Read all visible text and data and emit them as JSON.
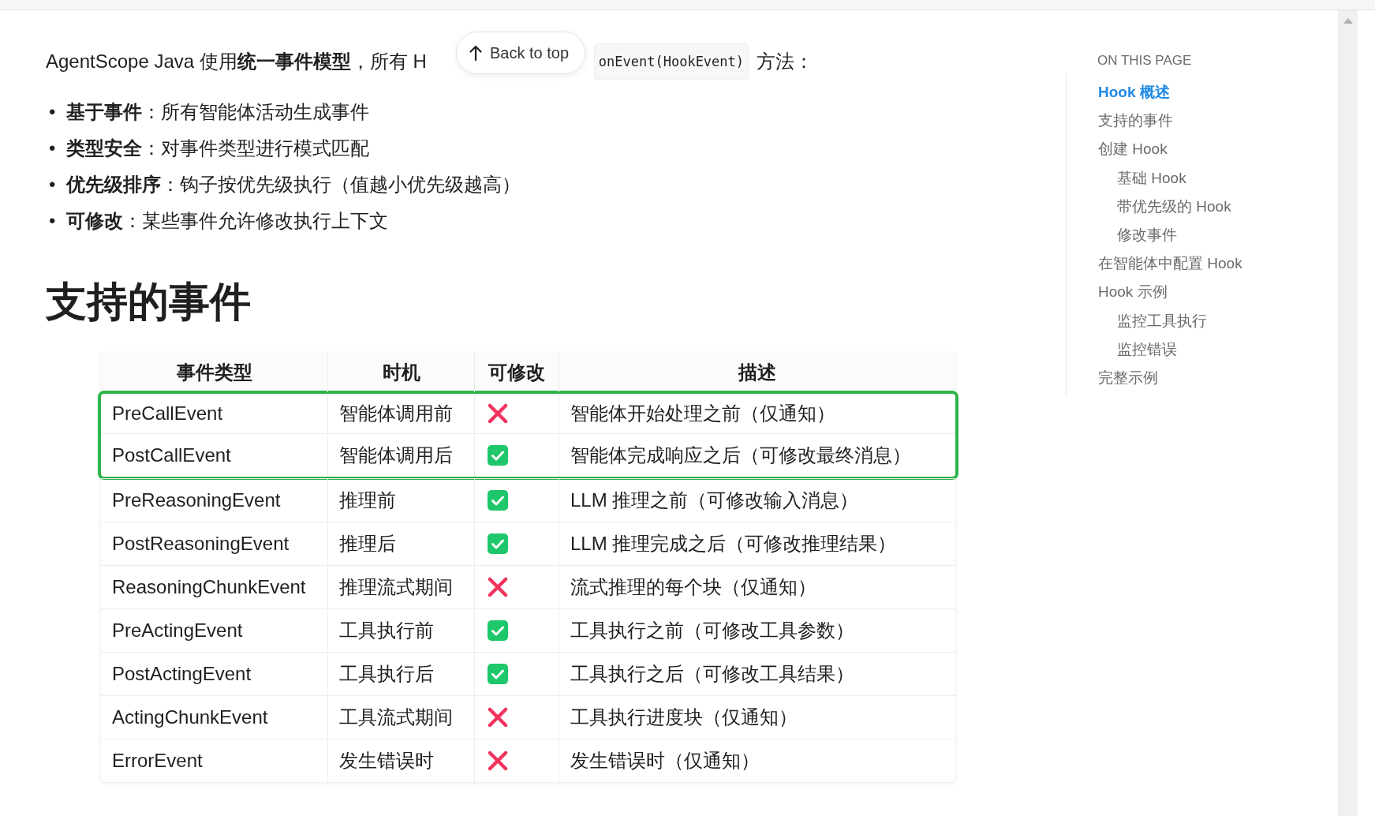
{
  "back_to_top": {
    "label": "Back to top"
  },
  "intro": {
    "before": "AgentScope Java 使用**统一事件模型**，所有 H",
    "code": "onEvent(HookEvent)",
    "after": "方法："
  },
  "bullets": [
    {
      "marker": "•",
      "text": "**基于事件**：所有智能体活动生成事件"
    },
    {
      "marker": "•",
      "text": "**类型安全**：对事件类型进行模式匹配"
    },
    {
      "marker": "•",
      "text": "**优先级排序**：钩子按优先级执行（值越小优先级越高）"
    },
    {
      "marker": "•",
      "text": "**可修改**：某些事件允许修改执行上下文"
    }
  ],
  "section_title": "支持的事件",
  "table": {
    "columns": [
      "事件类型",
      "时机",
      "可修改",
      "描述"
    ],
    "rows": [
      {
        "event": "PreCallEvent",
        "timing": "智能体调用前",
        "modifiable": false,
        "description": "智能体开始处理之前（仅通知）",
        "highlighted": true
      },
      {
        "event": "PostCallEvent",
        "timing": "智能体调用后",
        "modifiable": true,
        "description": "智能体完成响应之后（可修改最终消息）",
        "highlighted": true
      },
      {
        "event": "PreReasoningEvent",
        "timing": "推理前",
        "modifiable": true,
        "description": "LLM 推理之前（可修改输入消息）",
        "highlighted": false
      },
      {
        "event": "PostReasoningEvent",
        "timing": "推理后",
        "modifiable": true,
        "description": "LLM 推理完成之后（可修改推理结果）",
        "highlighted": false
      },
      {
        "event": "ReasoningChunkEvent",
        "timing": "推理流式期间",
        "modifiable": false,
        "description": "流式推理的每个块（仅通知）",
        "highlighted": false
      },
      {
        "event": "PreActingEvent",
        "timing": "工具执行前",
        "modifiable": true,
        "description": "工具执行之前（可修改工具参数）",
        "highlighted": false
      },
      {
        "event": "PostActingEvent",
        "timing": "工具执行后",
        "modifiable": true,
        "description": "工具执行之后（可修改工具结果）",
        "highlighted": false
      },
      {
        "event": "ActingChunkEvent",
        "timing": "工具流式期间",
        "modifiable": false,
        "description": "工具执行进度块（仅通知）",
        "highlighted": false
      },
      {
        "event": "ErrorEvent",
        "timing": "发生错误时",
        "modifiable": false,
        "description": "发生错误时（仅通知）",
        "highlighted": false
      }
    ]
  },
  "toc": {
    "title": "ON THIS PAGE",
    "items": [
      {
        "label": "Hook 概述",
        "selected": true
      },
      {
        "label": "支持的事件",
        "selected": false
      },
      {
        "label": "创建 Hook",
        "selected": false,
        "children": [
          {
            "label": "基础 Hook",
            "selected": false
          },
          {
            "label": "带优先级的 Hook",
            "selected": false
          },
          {
            "label": "修改事件",
            "selected": false
          }
        ]
      },
      {
        "label": "在智能体中配置 Hook",
        "selected": false
      },
      {
        "label": "Hook 示例",
        "selected": false,
        "children": [
          {
            "label": "监控工具执行",
            "selected": false
          },
          {
            "label": "监控错误",
            "selected": false
          }
        ]
      },
      {
        "label": "完整示例",
        "selected": false
      }
    ]
  }
}
